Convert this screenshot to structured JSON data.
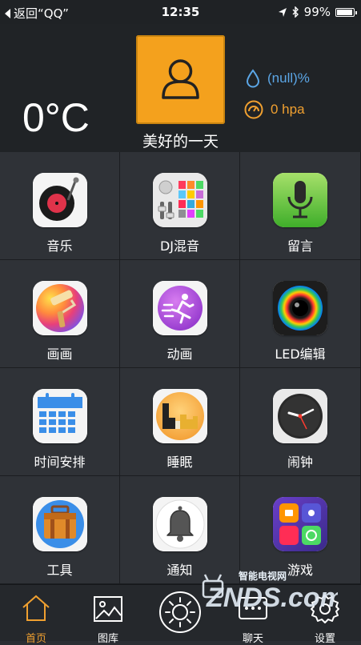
{
  "status_bar": {
    "back_label": "返回“QQ”",
    "time": "12:35",
    "battery": "99%",
    "battery_level": 0.99
  },
  "header": {
    "temperature": "0°C",
    "greeting": "美好的一天",
    "humidity": "(null)%",
    "pressure": "0 hpa",
    "avatar_color": "#f4a11d",
    "humidity_color": "#5ba6e6",
    "pressure_color": "#f0a030"
  },
  "grid": [
    {
      "label": "音乐",
      "icon": "music-record-icon"
    },
    {
      "label": "DJ混音",
      "icon": "dj-mixer-icon"
    },
    {
      "label": "留言",
      "icon": "microphone-icon"
    },
    {
      "label": "画画",
      "icon": "paint-roller-icon"
    },
    {
      "label": "动画",
      "icon": "running-man-icon"
    },
    {
      "label": "LED编辑",
      "icon": "camera-lens-icon"
    },
    {
      "label": "时间安排",
      "icon": "calendar-icon"
    },
    {
      "label": "睡眠",
      "icon": "sleep-bars-icon"
    },
    {
      "label": "闹钟",
      "icon": "clock-icon"
    },
    {
      "label": "工具",
      "icon": "toolbox-icon"
    },
    {
      "label": "通知",
      "icon": "bell-icon"
    },
    {
      "label": "游戏",
      "icon": "game-apps-icon"
    }
  ],
  "tabbar": [
    {
      "label": "首页",
      "icon": "home-icon",
      "active": true
    },
    {
      "label": "图库",
      "icon": "gallery-icon",
      "active": false
    },
    {
      "label": "",
      "icon": "sun-icon",
      "active": false
    },
    {
      "label": "聊天",
      "icon": "chat-icon",
      "active": false
    },
    {
      "label": "设置",
      "icon": "settings-gear-icon",
      "active": false
    }
  ],
  "watermark": {
    "text": "智能电视网",
    "logo": "ZNDS.com"
  },
  "accent_color": "#f0a030"
}
